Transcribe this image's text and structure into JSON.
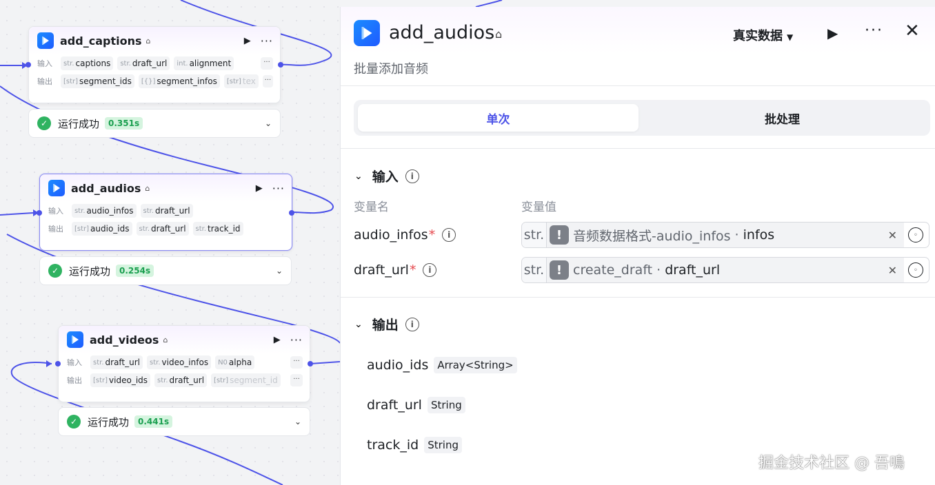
{
  "nodes": [
    {
      "title": "add_captions",
      "input_label": "输入",
      "output_label": "输出",
      "inputs": [
        {
          "type": "str.",
          "name": "captions"
        },
        {
          "type": "str.",
          "name": "draft_url"
        },
        {
          "type": "int.",
          "name": "alignment"
        }
      ],
      "outputs": [
        {
          "type": "[str]",
          "name": "segment_ids"
        },
        {
          "type": "[{}]",
          "name": "segment_infos"
        },
        {
          "type": "[str]",
          "name": "tex"
        }
      ],
      "more": "···",
      "status": "运行成功",
      "time": "0.351s"
    },
    {
      "title": "add_audios",
      "input_label": "输入",
      "output_label": "输出",
      "inputs": [
        {
          "type": "str.",
          "name": "audio_infos"
        },
        {
          "type": "str.",
          "name": "draft_url"
        }
      ],
      "outputs": [
        {
          "type": "[str]",
          "name": "audio_ids"
        },
        {
          "type": "str.",
          "name": "draft_url"
        },
        {
          "type": "str.",
          "name": "track_id"
        }
      ],
      "status": "运行成功",
      "time": "0.254s"
    },
    {
      "title": "add_videos",
      "input_label": "输入",
      "output_label": "输出",
      "inputs": [
        {
          "type": "str.",
          "name": "draft_url"
        },
        {
          "type": "str.",
          "name": "video_infos"
        },
        {
          "type": "N0",
          "name": "alpha"
        }
      ],
      "outputs": [
        {
          "type": "[str]",
          "name": "video_ids"
        },
        {
          "type": "str.",
          "name": "draft_url"
        },
        {
          "type": "[str]",
          "name": "segment_id"
        }
      ],
      "more": "···",
      "status": "运行成功",
      "time": "0.441s"
    }
  ],
  "panel": {
    "title": "add_audios",
    "description": "批量添加音频",
    "mode": "真实数据",
    "tabs": [
      "单次",
      "批处理"
    ],
    "input_section": "输入",
    "col_name": "变量名",
    "col_value": "变量值",
    "params": [
      {
        "name": "audio_infos",
        "required": "*",
        "type": "str.",
        "source": "音频数据格式-audio_infos",
        "sep": "·",
        "field": "infos"
      },
      {
        "name": "draft_url",
        "required": "*",
        "type": "str.",
        "source": "create_draft",
        "sep": "·",
        "field": "draft_url"
      }
    ],
    "output_section": "输出",
    "outputs": [
      {
        "name": "audio_ids",
        "type": "Array<String>"
      },
      {
        "name": "draft_url",
        "type": "String"
      },
      {
        "name": "track_id",
        "type": "String"
      }
    ]
  },
  "watermark": "掘金技术社区 @ 吾鳴",
  "colors": {
    "accent": "#4d53e8",
    "wire": "#4d53e8",
    "success": "#2fb361",
    "required": "#e5484d"
  },
  "icons": [
    "plugin-app-icon",
    "plugin-badge-icon",
    "play-icon",
    "more-icon",
    "close-icon",
    "check-circle-icon",
    "chevron-down-icon",
    "info-icon",
    "warning-icon",
    "clear-icon",
    "variable-picker-icon"
  ]
}
